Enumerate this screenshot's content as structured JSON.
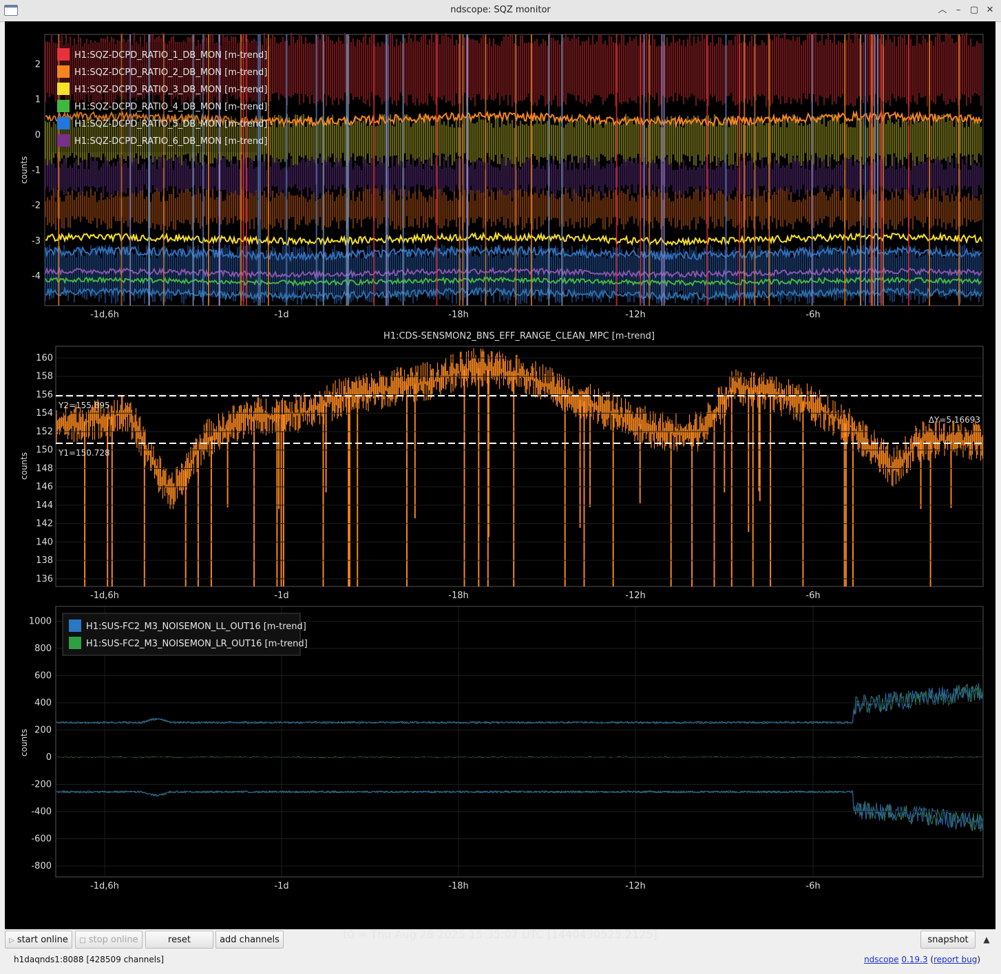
{
  "window": {
    "title": "ndscope: SQZ monitor",
    "controls": [
      "chevron-up",
      "minimize",
      "maximize",
      "close"
    ]
  },
  "plots": {
    "top": {
      "ylabel": "counts",
      "yticks": [
        "2",
        "1",
        "0",
        "-1",
        "-2",
        "-3",
        "-4"
      ],
      "xticks": [
        "-1d,6h",
        "-1d",
        "-18h",
        "-12h",
        "-6h"
      ],
      "legend": [
        {
          "label": "H1:SQZ-DCPD_RATIO_1_DB_MON [m-trend]",
          "color": "#e8323b"
        },
        {
          "label": "H1:SQZ-DCPD_RATIO_2_DB_MON [m-trend]",
          "color": "#f5861f"
        },
        {
          "label": "H1:SQZ-DCPD_RATIO_3_DB_MON [m-trend]",
          "color": "#f6e02a"
        },
        {
          "label": "H1:SQZ-DCPD_RATIO_4_DB_MON [m-trend]",
          "color": "#3fb83f"
        },
        {
          "label": "H1:SQZ-DCPD_RATIO_5_DB_MON [m-trend]",
          "color": "#2077e0"
        },
        {
          "label": "H1:SQZ-DCPD_RATIO_6_DB_MON [m-trend]",
          "color": "#7a2f8c"
        }
      ]
    },
    "middle": {
      "title": "H1:CDS-SENSMON2_BNS_EFF_RANGE_CLEAN_MPC [m-trend]",
      "ylabel": "counts",
      "yticks": [
        "160",
        "158",
        "156",
        "154",
        "152",
        "150",
        "148",
        "146",
        "144",
        "142",
        "140",
        "138",
        "136"
      ],
      "xticks": [
        "-1d,6h",
        "-1d",
        "-18h",
        "-12h",
        "-6h"
      ],
      "cursor_y2": "Y2=155.895",
      "cursor_y1": "Y1=150.728",
      "cursor_delta": "ΔY=5.16693",
      "trace_color": "#f5861f"
    },
    "bottom": {
      "ylabel": "counts",
      "yticks": [
        "1000",
        "800",
        "600",
        "400",
        "200",
        "0",
        "-200",
        "-400",
        "-600",
        "-800"
      ],
      "xticks": [
        "-1d,6h",
        "-1d",
        "-18h",
        "-12h",
        "-6h"
      ],
      "legend": [
        {
          "label": "H1:SUS-FC2_M3_NOISEMON_LL_OUT16 [m-trend]",
          "color": "#2a78c4"
        },
        {
          "label": "H1:SUS-FC2_M3_NOISEMON_LR_OUT16 [m-trend]",
          "color": "#2ea043"
        }
      ]
    }
  },
  "t0": "t0 = Thu Aug 28 2025 15:35:07 UTC [1440430525.2125]",
  "toolbar": {
    "start_online": "start online",
    "stop_online": "stop online",
    "reset": "reset",
    "add_channels": "add channels",
    "snapshot": "snapshot"
  },
  "status": {
    "server": "h1daqnds1:8088  [428509 channels]",
    "app_name": "ndscope",
    "version": "0.19.3",
    "report_bug": "report bug"
  }
}
